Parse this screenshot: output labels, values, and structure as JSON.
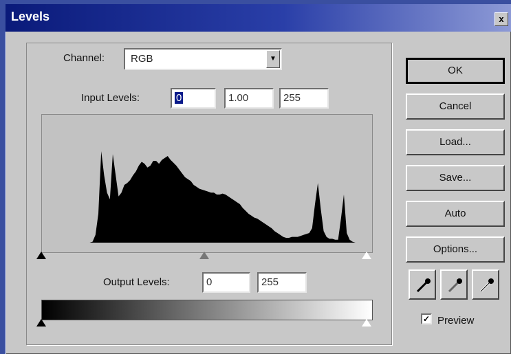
{
  "window": {
    "title": "Levels",
    "close_symbol": "x"
  },
  "channel": {
    "label": "Channel:",
    "value": "RGB"
  },
  "input_levels": {
    "label": "Input Levels:",
    "black": "0",
    "gamma": "1.00",
    "white": "255"
  },
  "output_levels": {
    "label": "Output Levels:",
    "black": "0",
    "white": "255"
  },
  "histogram": {
    "profile": [
      0,
      0,
      0,
      0,
      0,
      0,
      0,
      0,
      1,
      8,
      30,
      95,
      70,
      52,
      45,
      92,
      70,
      48,
      52,
      60,
      62,
      65,
      70,
      74,
      80,
      84,
      82,
      78,
      80,
      85,
      85,
      82,
      86,
      88,
      90,
      86,
      83,
      80,
      76,
      72,
      68,
      66,
      64,
      60,
      58,
      56,
      55,
      54,
      53,
      52,
      52,
      50,
      50,
      51,
      50,
      48,
      46,
      44,
      42,
      40,
      36,
      33,
      30,
      28,
      26,
      25,
      23,
      21,
      19,
      17,
      15,
      12,
      10,
      8,
      6,
      5,
      5,
      6,
      6,
      6,
      7,
      8,
      9,
      10,
      15,
      40,
      62,
      35,
      12,
      6,
      4,
      4,
      3,
      3,
      25,
      50,
      10,
      3,
      1,
      0,
      0
    ]
  },
  "buttons": {
    "ok": "OK",
    "cancel": "Cancel",
    "load": "Load...",
    "save": "Save...",
    "auto": "Auto",
    "options": "Options..."
  },
  "preview": {
    "label": "Preview",
    "checked": true
  }
}
